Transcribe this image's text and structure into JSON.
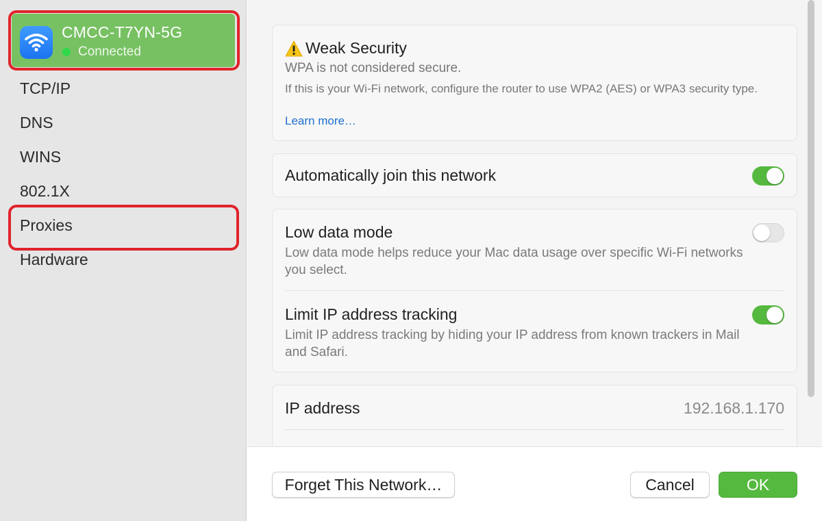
{
  "sidebar": {
    "network": {
      "name": "CMCC-T7YN-5G",
      "status": "Connected",
      "icon": "wifi-icon"
    },
    "items": [
      {
        "label": "TCP/IP"
      },
      {
        "label": "DNS"
      },
      {
        "label": "WINS"
      },
      {
        "label": "802.1X"
      },
      {
        "label": "Proxies"
      },
      {
        "label": "Hardware"
      }
    ]
  },
  "main": {
    "security": {
      "title": "Weak Security",
      "subtitle": "WPA is not considered secure.",
      "description": "If this is your Wi-Fi network, configure the router to use WPA2 (AES) or WPA3 security type.",
      "link": "Learn more…"
    },
    "auto_join": {
      "label": "Automatically join this network",
      "enabled": true
    },
    "low_data": {
      "label": "Low data mode",
      "description": "Low data mode helps reduce your Mac data usage over specific Wi-Fi networks you select.",
      "enabled": false
    },
    "limit_ip": {
      "label": "Limit IP address tracking",
      "description": "Limit IP address tracking by hiding your IP address from known trackers in Mail and Safari.",
      "enabled": true
    },
    "ip": {
      "label": "IP address",
      "value": "192.168.1.170"
    }
  },
  "footer": {
    "forget_label": "Forget This Network…",
    "cancel_label": "Cancel",
    "ok_label": "OK"
  },
  "colors": {
    "accent_green": "#55b93f",
    "highlight_red": "#e0232b",
    "link_blue": "#1f6fd1"
  }
}
